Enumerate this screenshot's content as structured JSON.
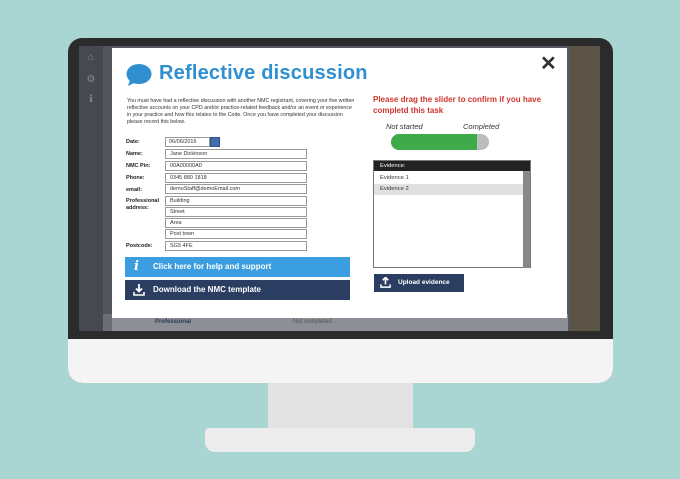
{
  "modal": {
    "title": "Reflective discussion",
    "close_label": "✕",
    "intro": "You must have had a reflective discussion with another NMC registrant, covering your five written reflective accounts on your CPD and/or practice-related feedback and/or an event or experience in your practice and how this relates to the Code. Once you have completed your discussion please record this below."
  },
  "form": {
    "date_label": "Date:",
    "date_value": "06/06/2016",
    "name_label": "Name:",
    "name_value": "Jane Dickinson",
    "pin_label": "NMC Pin:",
    "pin_value": "00A00000A0",
    "phone_label": "Phone:",
    "phone_value": "0345 880 1818",
    "email_label": "email:",
    "email_value": "demoStaff@demoEmail.com",
    "address_label_1": "Professional",
    "address_label_2": "address:",
    "address_lines": [
      "Building",
      "Street",
      "Area",
      "Post town"
    ],
    "postcode_label": "Postcode:",
    "postcode_value": "SG5 4FE"
  },
  "buttons": {
    "help": "Click here for help and support",
    "download": "Download the NMC template",
    "upload": "Upload evidence"
  },
  "confirm": {
    "prompt": "Please drag the slider to confirm if you have completd this task",
    "left_label": "Not started",
    "right_label": "Completed",
    "progress": 0.88
  },
  "evidence": {
    "header": "Evidence:",
    "items": [
      "Evidence 1",
      "Evidence 2"
    ]
  },
  "background": {
    "row_label": "Professional",
    "row_status": "Not completed"
  },
  "colors": {
    "accent": "#2f8fd0",
    "help_button": "#3b9ee0",
    "dark_button": "#2b3e62",
    "prompt": "#d0342c",
    "slider_fill": "#3eaa4a"
  }
}
